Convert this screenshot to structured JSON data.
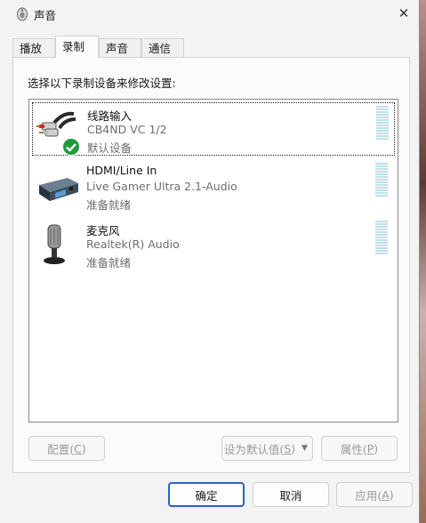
{
  "window": {
    "title": "声音",
    "close_glyph": "✕"
  },
  "tabs": [
    {
      "label": "播放",
      "active": false
    },
    {
      "label": "录制",
      "active": true
    },
    {
      "label": "声音",
      "active": false
    },
    {
      "label": "通信",
      "active": false
    }
  ],
  "instruction": "选择以下录制设备来修改设置:",
  "devices": [
    {
      "name": "线路输入",
      "description": "CB4ND VC 1/2",
      "status": "默认设备",
      "icon": "rca-cable-icon",
      "default_badge": "check-badge-icon",
      "selected": true
    },
    {
      "name": "HDMI/Line In",
      "description": "Live Gamer Ultra 2.1-Audio",
      "status": "准备就绪",
      "icon": "capture-card-icon",
      "selected": false
    },
    {
      "name": "麦克风",
      "description": "Realtek(R) Audio",
      "status": "准备就绪",
      "icon": "microphone-icon",
      "selected": false
    }
  ],
  "buttons": {
    "configure": {
      "label": "配置(",
      "key": "C",
      "suffix": ")",
      "enabled": false
    },
    "set_default": {
      "label": "设为默认值(",
      "key": "S",
      "suffix": ")",
      "enabled": false
    },
    "properties": {
      "label": "属性(",
      "key": "P",
      "suffix": ")",
      "enabled": false
    },
    "ok": {
      "label": "确定",
      "enabled": true
    },
    "cancel": {
      "label": "取消",
      "enabled": true
    },
    "apply": {
      "label": "应用(",
      "key": "A",
      "suffix": ")",
      "enabled": false
    }
  },
  "colors": {
    "accent": "#2b62c8",
    "meter": "#bfe0e5",
    "check": "#1f9a3a"
  }
}
